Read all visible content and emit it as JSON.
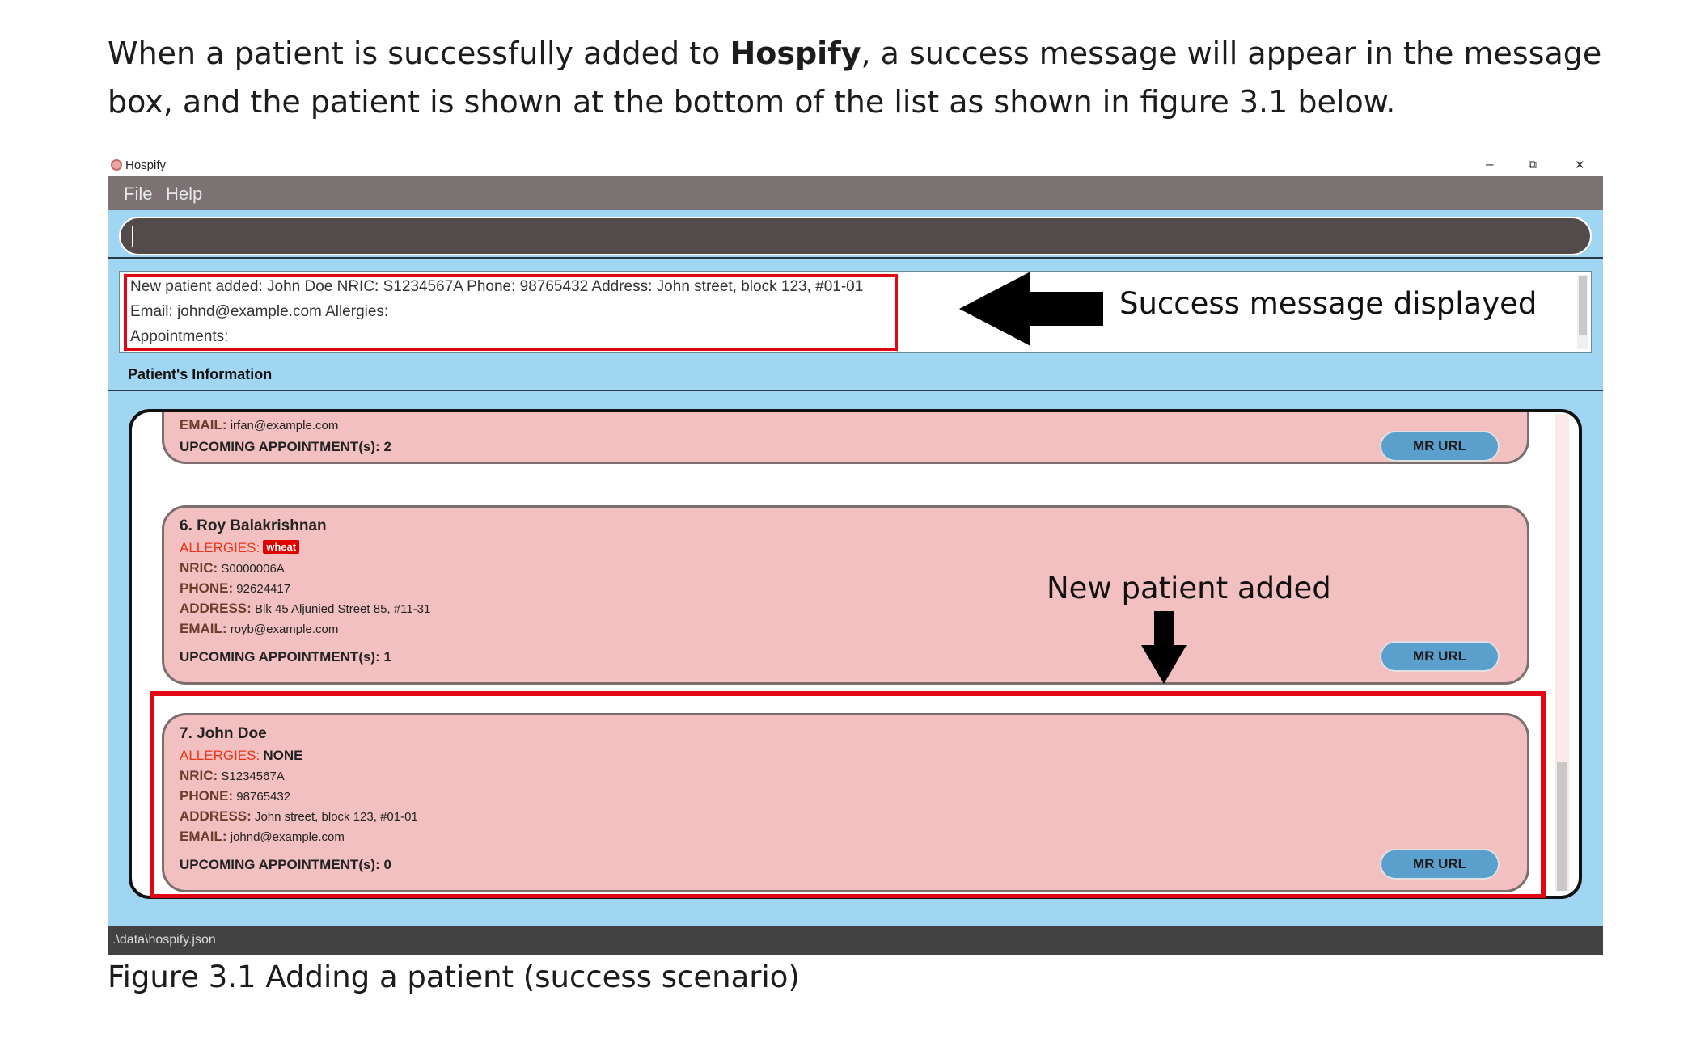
{
  "intro": {
    "part1": "When a patient is successfully added to ",
    "bold": "Hospify",
    "part2": ", a success message will appear in the message box, and the patient is shown at the bottom of the list as shown in figure 3.1 below."
  },
  "window": {
    "title": "Hospify",
    "minimize": "–",
    "restore": "⧉",
    "close": "✕"
  },
  "menu": {
    "file": "File",
    "help": "Help"
  },
  "command": {
    "value": ""
  },
  "result": {
    "line1": "New patient added: John Doe NRIC: S1234567A Phone: 98765432 Address: John street, block 123, #01-01",
    "line2": "Email: johnd@example.com Allergies:",
    "line3": "Appointments:"
  },
  "annotations": {
    "success": "Success message displayed",
    "new_patient": "New patient added"
  },
  "section": {
    "title": "Patient's Information"
  },
  "labels": {
    "allergies": "ALLERGIES:",
    "nric": "NRIC:",
    "phone": "PHONE:",
    "address": "ADDRESS:",
    "email": "EMAIL:",
    "mr_url": "MR URL"
  },
  "patients": [
    {
      "email": "irfan@example.com",
      "upcoming": "UPCOMING APPOINTMENT(s): 2"
    },
    {
      "name": "6.  Roy Balakrishnan",
      "allergy_tag": "wheat",
      "nric": "S0000006A",
      "phone": "92624417",
      "address": "Blk 45 Aljunied Street 85, #11-31",
      "email": "royb@example.com",
      "upcoming": "UPCOMING APPOINTMENT(s): 1"
    },
    {
      "name": "7.  John Doe",
      "allergies": "NONE",
      "nric": "S1234567A",
      "phone": "98765432",
      "address": "John street, block 123, #01-01",
      "email": "johnd@example.com",
      "upcoming": "UPCOMING APPOINTMENT(s): 0"
    }
  ],
  "status": {
    "path": ".\\data\\hospify.json"
  },
  "caption": "Figure 3.1 Adding a patient (success scenario)",
  "colors": {
    "window_bg": "#a0d6f2",
    "menubar": "#7b7373",
    "command_box": "#534b4b",
    "card": "#f2c0c0",
    "highlight": "#e30613",
    "mr_button": "#5b9fcd",
    "allergy_label": "#e8351a"
  }
}
